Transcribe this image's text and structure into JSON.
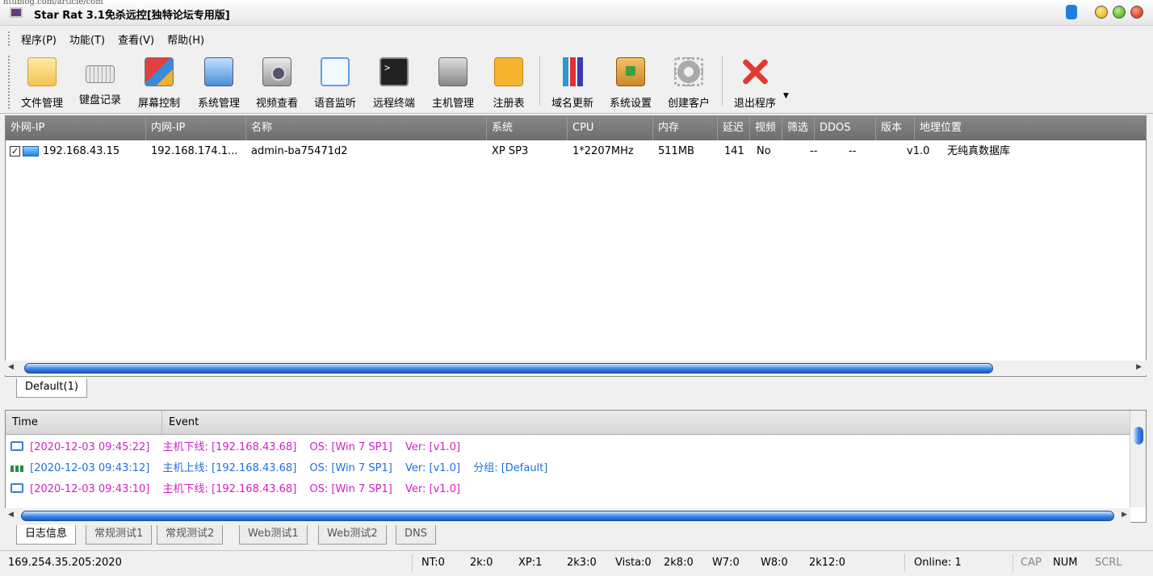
{
  "window": {
    "watermark": "ntublog.com/article/com",
    "title": "Star Rat 3.1免杀远控[独特论坛专用版]"
  },
  "menu": [
    "程序(P)",
    "功能(T)",
    "查看(V)",
    "帮助(H)"
  ],
  "toolbar": [
    {
      "label": "文件管理",
      "icon": "folder-icon"
    },
    {
      "label": "键盘记录",
      "icon": "keyboard-icon"
    },
    {
      "label": "屏幕控制",
      "icon": "screen-control-icon"
    },
    {
      "label": "系统管理",
      "icon": "system-manage-icon"
    },
    {
      "label": "视频查看",
      "icon": "camera-icon"
    },
    {
      "label": "语音监听",
      "icon": "speech-bubble-icon"
    },
    {
      "label": "远程终端",
      "icon": "terminal-icon"
    },
    {
      "label": "主机管理",
      "icon": "server-icon"
    },
    {
      "label": "注册表",
      "icon": "registry-puzzle-icon"
    },
    {
      "label": "域名更新",
      "icon": "bar-chart-icon"
    },
    {
      "label": "系统设置",
      "icon": "settings-box-icon"
    },
    {
      "label": "创建客户",
      "icon": "gear-icon"
    },
    {
      "label": "退出程序",
      "icon": "close-x-icon"
    }
  ],
  "hosts": {
    "columns": [
      "外网-IP",
      "内网-IP",
      "名称",
      "系统",
      "CPU",
      "内存",
      "延迟",
      "视频",
      "筛选",
      "DDOS",
      "版本",
      "地理位置"
    ],
    "rows": [
      {
        "external_ip": "192.168.43.15",
        "internal_ip": "192.168.174.1...",
        "name": "admin-ba75471d2",
        "os": "XP SP3",
        "cpu": "1*2207MHz",
        "memory": "511MB",
        "latency": "141",
        "video": "No",
        "filter": "--",
        "ddos": "--",
        "version": "v1.0",
        "location": "无纯真数据库",
        "checked": true
      }
    ],
    "group_tab": "Default(1)"
  },
  "log": {
    "columns": [
      "Time",
      "Event"
    ],
    "entries": [
      {
        "type": "offline",
        "time": "[2020-12-03 09:45:22]",
        "event": "主机下线: [192.168.43.68]",
        "os": "OS: [Win 7 SP1]",
        "ver": "Ver: [v1.0]",
        "group": "",
        "color": "#d21fc8"
      },
      {
        "type": "online",
        "time": "[2020-12-03 09:43:12]",
        "event": "主机上线: [192.168.43.68]",
        "os": "OS: [Win 7 SP1]",
        "ver": "Ver: [v1.0]",
        "group": "分组: [Default]",
        "color": "#1f6fe0"
      },
      {
        "type": "offline",
        "time": "[2020-12-03 09:43:10]",
        "event": "主机下线: [192.168.43.68]",
        "os": "OS: [Win 7 SP1]",
        "ver": "Ver: [v1.0]",
        "group": "",
        "color": "#d21fc8"
      }
    ],
    "tabs": [
      "日志信息",
      "常规测试1",
      "常规测试2",
      "Web测试1",
      "Web测试2",
      "DNS"
    ]
  },
  "status": {
    "address": "169.254.35.205:2020",
    "nt": "NT:0",
    "k2": "2k:0",
    "xp": "XP:1",
    "k2k3": "2k3:0",
    "vista": "Vista:0",
    "k2k8": "2k8:0",
    "w7": "W7:0",
    "w8": "W8:0",
    "k2k12": "2k12:0",
    "online": "Online: 1",
    "cap": "CAP",
    "num": "NUM",
    "scrl": "SCRL"
  }
}
